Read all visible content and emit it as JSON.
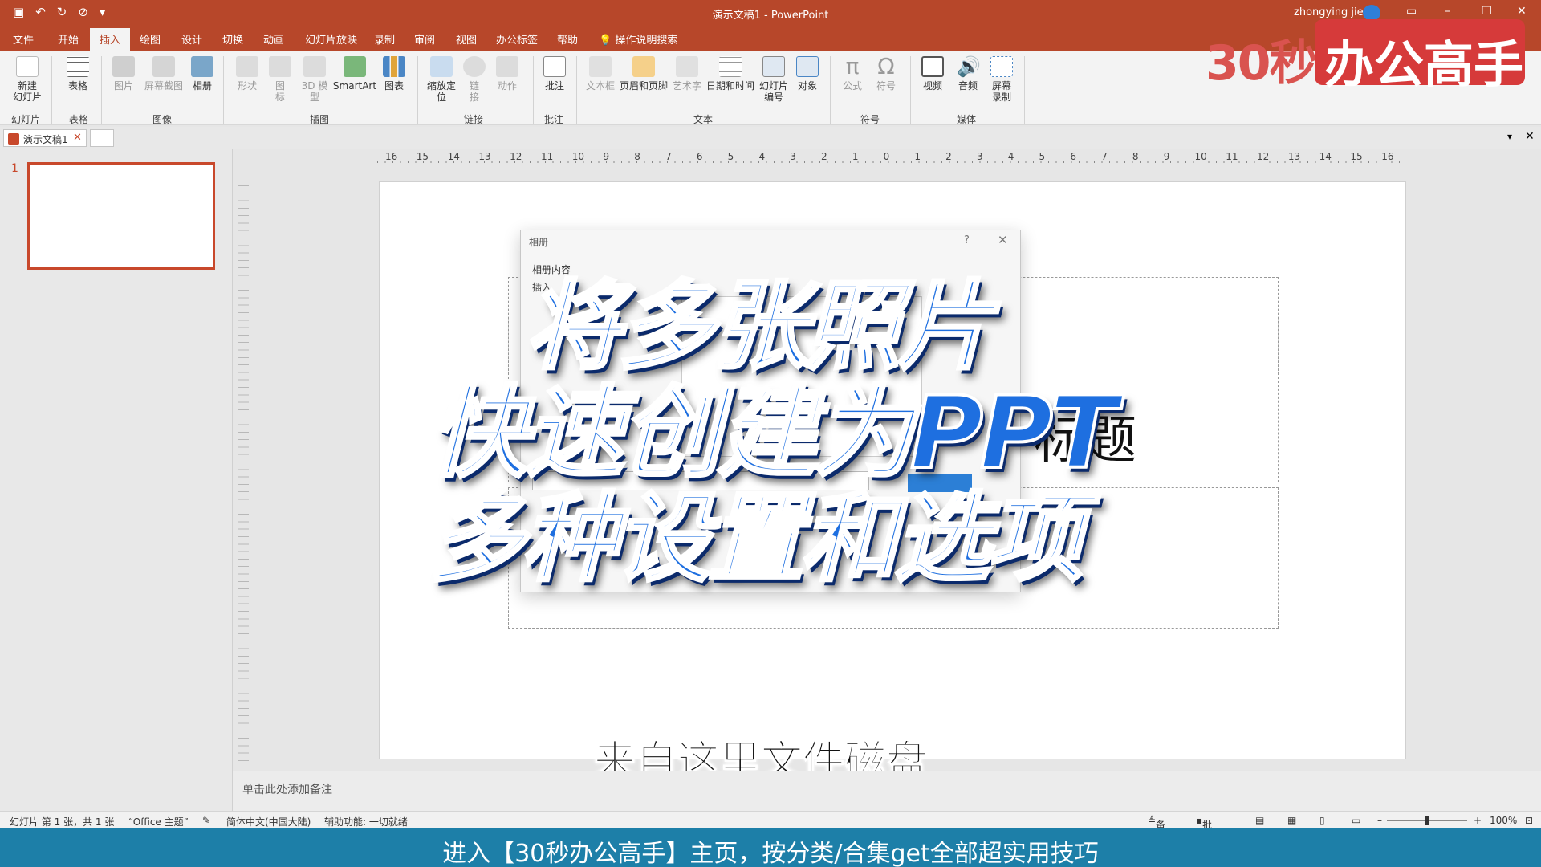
{
  "titlebar": {
    "doc_title": "演示文稿1 - PowerPoint",
    "user": "zhongying jie",
    "qat": [
      "save",
      "undo",
      "redo",
      "repeat",
      "customize"
    ]
  },
  "tabs": [
    "文件",
    "开始",
    "插入",
    "绘图",
    "设计",
    "切换",
    "动画",
    "幻灯片放映",
    "录制",
    "审阅",
    "视图",
    "办公标签",
    "帮助"
  ],
  "active_tab": "插入",
  "search_tab": "操作说明搜索",
  "ribbon": {
    "buttons": {
      "new_slide": "新建\n幻灯片",
      "table": "表格",
      "picture": "图片",
      "screenshot": "屏幕截图",
      "album": "相册",
      "shapes": "形状",
      "icons": "图\n标",
      "model3d": "3D 模\n型",
      "smartart": "SmartArt",
      "chart": "图表",
      "zoom": "缩放定\n位",
      "link": "链\n接",
      "action": "动作",
      "comment": "批注",
      "textbox": "文本框",
      "header_footer": "页眉和页脚",
      "wordart": "艺术字",
      "datetime": "日期和时间",
      "slide_number": "幻灯片\n编号",
      "object": "对象",
      "equation": "公式",
      "symbol": "符号",
      "video": "视频",
      "audio": "音频",
      "screen_record": "屏幕\n录制"
    },
    "groups": {
      "slides": "幻灯片",
      "tables": "表格",
      "images": "图像",
      "illustrations": "插图",
      "links": "链接",
      "comments": "批注",
      "text": "文本",
      "symbols": "符号",
      "media": "媒体"
    }
  },
  "logo": {
    "prefix": "30秒",
    "box_text": "办公高手"
  },
  "doc_tab": {
    "name": "演示文稿1"
  },
  "thumbnail": {
    "number": "1"
  },
  "ruler": [
    "16",
    "15",
    "14",
    "13",
    "12",
    "11",
    "10",
    "9",
    "8",
    "7",
    "6",
    "5",
    "4",
    "3",
    "2",
    "1",
    "0",
    "1",
    "2",
    "3",
    "4",
    "5",
    "6",
    "7",
    "8",
    "9",
    "10",
    "11",
    "12",
    "13",
    "14",
    "15",
    "16"
  ],
  "slide": {
    "title_partial": "标题"
  },
  "dialog": {
    "title": "相册",
    "help": "?",
    "section": "相册内容",
    "insert_label": "插入"
  },
  "overlay": {
    "line1": "将多张照片",
    "line2": "快速创建为PPT",
    "line3": "多种设置和选项",
    "subtitle": "来自这里文件磁盘"
  },
  "notes": {
    "placeholder": "单击此处添加备注"
  },
  "status": {
    "slide_info": "幻灯片 第 1 张，共 1 张",
    "theme": "“Office 主题”",
    "language": "简体中文(中国大陆)",
    "accessibility": "辅助功能: 一切就绪",
    "notes_btn": "备注",
    "comments_btn": "批注",
    "zoom": "100%"
  },
  "banner": {
    "text": "进入【30秒办公高手】主页，按分类/合集get全部超实用技巧"
  },
  "colors": {
    "accent": "#b7472a",
    "headline": "#1e6fe0",
    "banner": "#1d7fa8",
    "logo_red": "#d63a3a"
  }
}
